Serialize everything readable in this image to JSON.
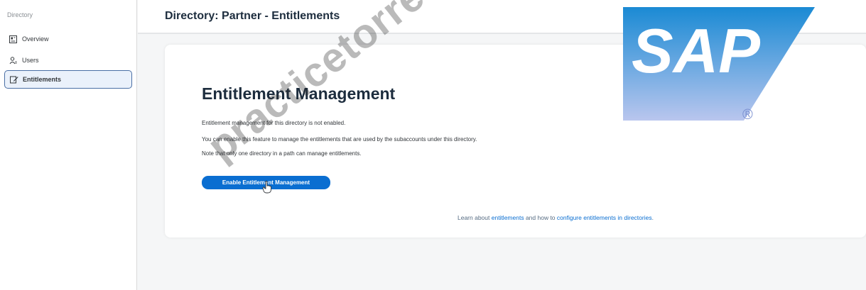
{
  "sidebar": {
    "header": "Directory",
    "items": [
      {
        "label": "Overview",
        "icon": "overview-icon"
      },
      {
        "label": "Users",
        "icon": "users-icon"
      },
      {
        "label": "Entitlements",
        "icon": "entitlements-icon",
        "active": true
      }
    ]
  },
  "header": {
    "title": "Directory: Partner - Entitlements"
  },
  "main": {
    "heading": "Entitlement Management",
    "paragraphs": [
      "Entitlement management for this directory is not enabled.",
      "You can enable this feature to manage the entitlements that are used by the subaccounts under this directory.",
      "Note that only one directory in a path can manage entitlements."
    ],
    "enable_button": "Enable Entitlement Management",
    "learn_prefix": "Learn about ",
    "learn_link1": "entitlements",
    "learn_middle": " and how to ",
    "learn_link2": "configure entitlements in directories",
    "learn_suffix": "."
  },
  "logo": {
    "text": "SAP",
    "registered": "®"
  },
  "watermark": "practicetorrent.com",
  "colors": {
    "accent": "#0a6ed1",
    "logo_gradient_top": "#1a8ad4",
    "logo_gradient_bottom": "#b9c6ee"
  }
}
